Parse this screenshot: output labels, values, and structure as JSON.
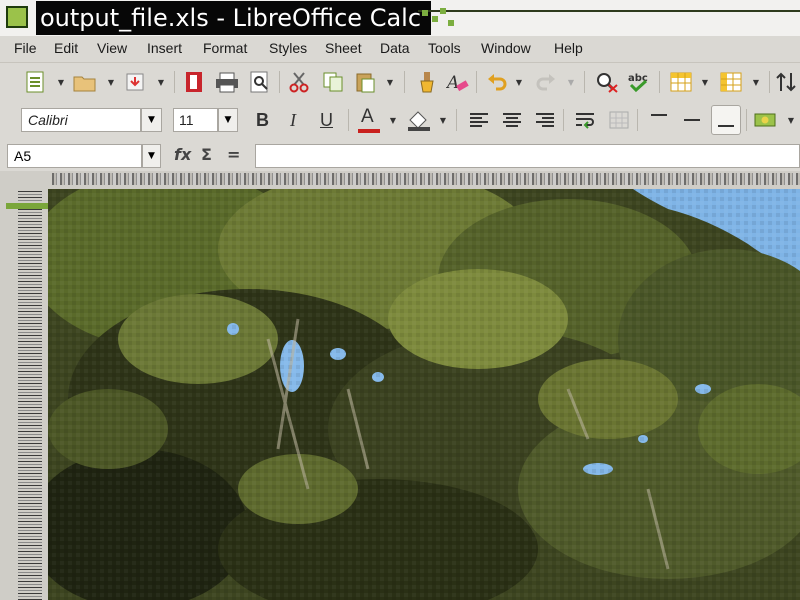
{
  "window": {
    "title": "output_file.xls - LibreOffice Calc"
  },
  "menu": [
    "File",
    "Edit",
    "View",
    "Insert",
    "Format",
    "Styles",
    "Sheet",
    "Data",
    "Tools",
    "Window",
    "Help"
  ],
  "toolbar_standard": {
    "icons": [
      "new-document-icon",
      "open-folder-icon",
      "save-icon",
      "export-pdf-icon",
      "print-icon",
      "print-preview-icon",
      "cut-icon",
      "copy-icon",
      "paste-icon",
      "clone-formatting-icon",
      "clear-formatting-icon",
      "undo-icon",
      "redo-icon",
      "find-replace-icon",
      "spelling-icon",
      "row-icon",
      "column-icon",
      "sort-icon"
    ]
  },
  "toolbar_formatting": {
    "font_name": "Calibri",
    "font_size": "11",
    "bold": "B",
    "italic": "I",
    "underline": "U",
    "font_color_letter": "A"
  },
  "formula_bar": {
    "cell_reference": "A5",
    "function_wizard": "fx",
    "sum_symbol": "Σ",
    "formula_symbol": "=",
    "formula_value": ""
  },
  "sheet": {
    "content": "photo of dense green tree foliage against blue sky",
    "active_row_highlight": "#7aa63a"
  },
  "colors": {
    "accent": "#7aa63a",
    "title_bg": "#070707",
    "foliage": "#4d5a26",
    "sky": "#7fb4e6"
  }
}
